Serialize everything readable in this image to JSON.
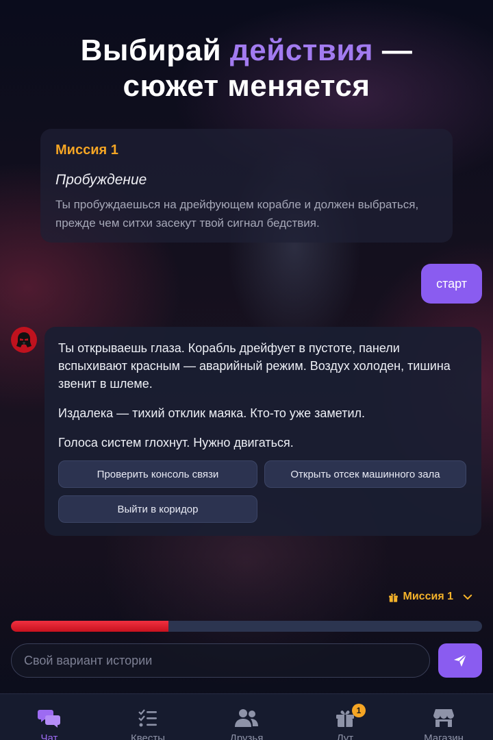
{
  "hero": {
    "line1_before": "Выбирай ",
    "line1_accent": "действия",
    "line1_after": " —",
    "line2": "сюжет меняется"
  },
  "mission_card": {
    "title": "Миссия 1",
    "subtitle": "Пробуждение",
    "description": "Ты пробуждаешься на дрейфующем корабле и должен выбраться, прежде чем ситхи засекут твой сигнал бедствия."
  },
  "user_message": "старт",
  "bot_message": {
    "avatar_icon": "sith-helmet-icon",
    "paragraphs": [
      "Ты открываешь глаза. Корабль дрейфует в пустоте, панели вспыхивают красным — аварийный режим. Воздух холоден, тишина звенит в шлеме.",
      "Издалека — тихий отклик маяка. Кто-то уже заметил.",
      "Голоса систем глохнут. Нужно двигаться."
    ],
    "choices": [
      "Проверить консоль связи",
      "Открыть отсек машинного зала",
      "Выйти в коридор"
    ]
  },
  "mission_selector": {
    "label": "Миссия 1",
    "icon": "gift-icon"
  },
  "progress": {
    "fraction": 0.335,
    "color": "#e8202e"
  },
  "input": {
    "placeholder": "Свой вариант истории"
  },
  "nav": {
    "items": [
      {
        "label": "Чат",
        "icon": "chat-icon",
        "active": true
      },
      {
        "label": "Квесты",
        "icon": "checklist-icon",
        "active": false
      },
      {
        "label": "Друзья",
        "icon": "users-icon",
        "active": false
      },
      {
        "label": "Лут",
        "icon": "gift-icon",
        "active": false,
        "badge": "1"
      },
      {
        "label": "Магазин",
        "icon": "store-icon",
        "active": false
      }
    ]
  },
  "colors": {
    "accent": "#8a5cf0",
    "gold": "#f5a524",
    "danger": "#e8202e"
  }
}
